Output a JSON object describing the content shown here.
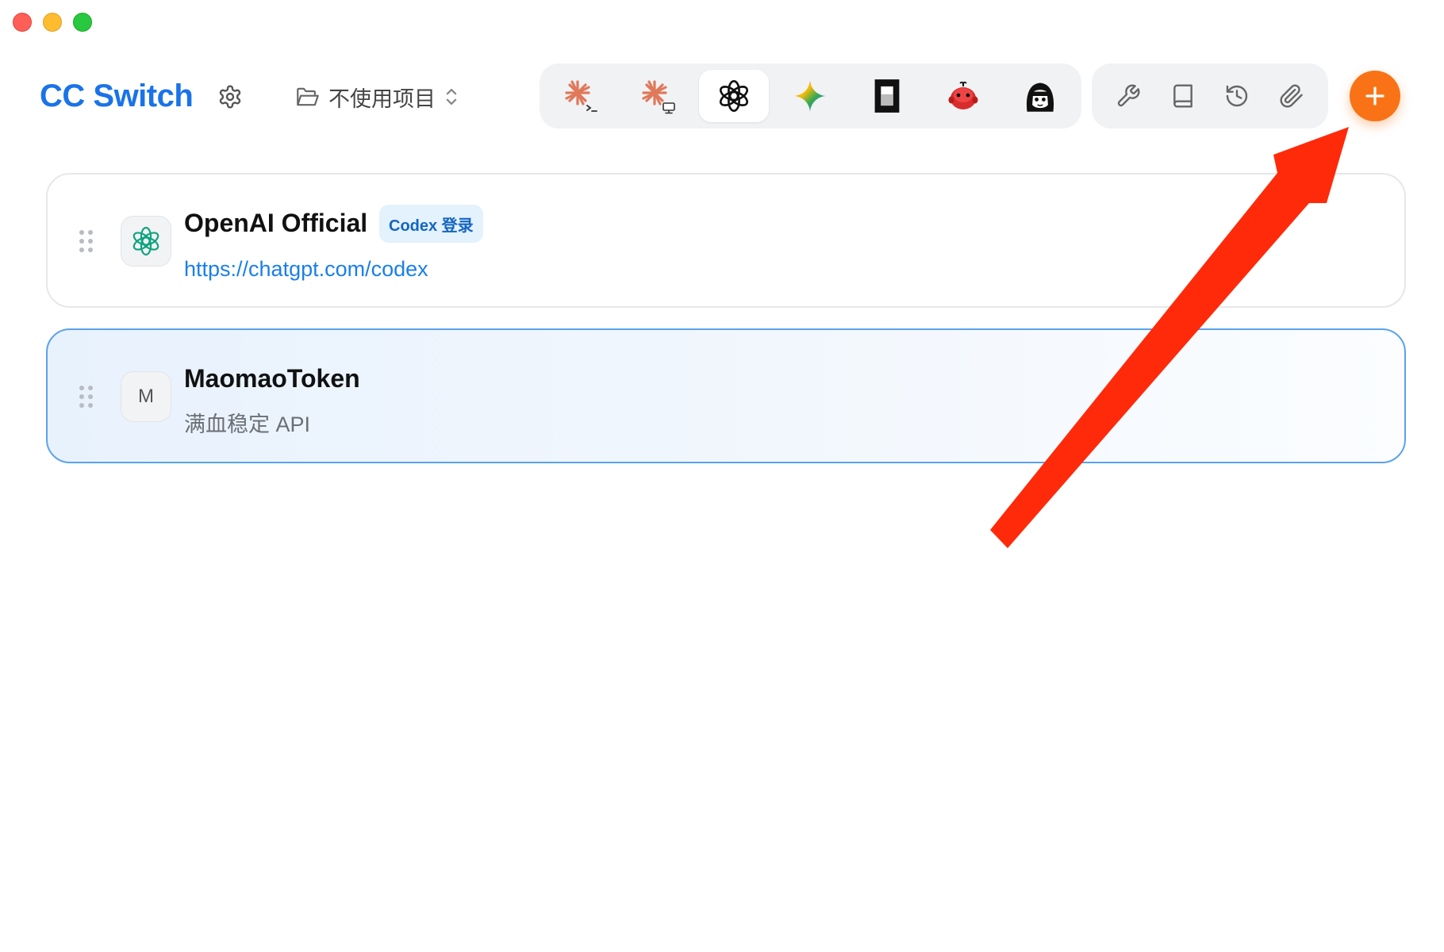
{
  "window": {
    "controls": [
      "close",
      "minimize",
      "maximize"
    ]
  },
  "header": {
    "title": "CC Switch",
    "settings_icon": "gear-icon",
    "project_selector": {
      "label": "不使用项目",
      "icon": "folder-open-icon",
      "chevron_icon": "chevron-up-down-icon"
    },
    "apps": [
      {
        "name": "claude-code",
        "icon": "claude-terminal-icon",
        "active": false
      },
      {
        "name": "claude-desktop",
        "icon": "claude-desktop-icon",
        "active": false
      },
      {
        "name": "codex",
        "icon": "openai-icon",
        "active": true
      },
      {
        "name": "gemini",
        "icon": "gemini-star-icon",
        "active": false
      },
      {
        "name": "opencode",
        "icon": "opencode-icon",
        "active": false
      },
      {
        "name": "red-mascot",
        "icon": "red-mascot-icon",
        "active": false
      },
      {
        "name": "manga-avatar",
        "icon": "manga-avatar-icon",
        "active": false
      }
    ],
    "tools": [
      {
        "name": "tools",
        "icon": "wrench-icon"
      },
      {
        "name": "docs",
        "icon": "book-icon"
      },
      {
        "name": "history",
        "icon": "history-icon"
      },
      {
        "name": "attachments",
        "icon": "paperclip-icon"
      }
    ],
    "add_icon": "plus-icon",
    "add_color": "#f97316"
  },
  "providers": [
    {
      "name": "OpenAI Official",
      "badge": "Codex 登录",
      "subtitle": "https://chatgpt.com/codex",
      "subtitle_is_link": true,
      "avatar_icon": "openai-icon",
      "selected": false
    },
    {
      "name": "MaomaoToken",
      "badge": "",
      "subtitle": "满血稳定 API",
      "subtitle_is_link": false,
      "avatar_letter": "M",
      "selected": true
    }
  ],
  "annotation": {
    "arrow_color": "#ff2a0a",
    "points_to": "add-provider-button"
  },
  "colors": {
    "brand": "#1a73e8",
    "link": "#1a7fe8",
    "selected_border": "#5aa2ec"
  }
}
